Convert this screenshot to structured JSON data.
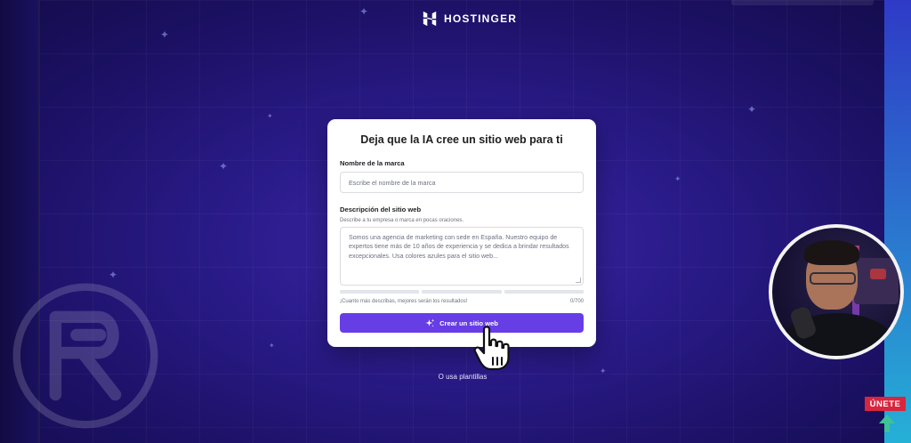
{
  "brand": {
    "name": "HOSTINGER"
  },
  "card": {
    "title": "Deja que la IA cree un sitio web para ti",
    "brand_name_label": "Nombre de la marca",
    "brand_name_placeholder": "Escribe el nombre de la marca",
    "description_label": "Descripción del sitio web",
    "description_helper": "Describe a tu empresa o marca en pocas oraciones.",
    "description_value": "Somos una agencia de marketing con sede en España. Nuestro equipo de expertos tiene más de 10 años de experiencia y se dedica a brindar resultados excepcionales. Usa colores azules para el sitio web...",
    "hint": "¡Cuanto más describas, mejores serán los resultados!",
    "char_count": "0/700",
    "cta_label": "Crear un sitio web"
  },
  "alt_link": "O usa plantillas",
  "join_badge": "ÚNETE",
  "colors": {
    "accent": "#673de6",
    "background": "#2a1b8a",
    "join_badge": "#d7263d"
  },
  "icons": [
    "hostinger-logo-icon",
    "sparkles-icon",
    "hand-cursor-icon",
    "channel-emblem-icon",
    "up-arrow-icon"
  ]
}
